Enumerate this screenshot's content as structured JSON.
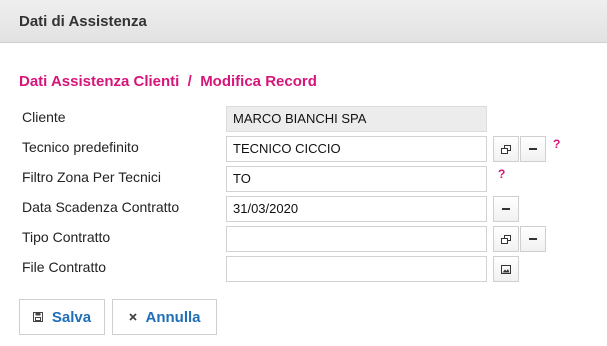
{
  "header": {
    "title": "Dati di Assistenza"
  },
  "breadcrumb": {
    "section": "Dati Assistenza Clienti",
    "separator": "/",
    "page": "Modifica Record"
  },
  "form": {
    "cliente": {
      "label": "Cliente",
      "value": "MARCO BIANCHI SPA"
    },
    "tecnico": {
      "label": "Tecnico predefinito",
      "value": "TECNICO CICCIO",
      "help": "?"
    },
    "filtro": {
      "label": "Filtro Zona Per Tecnici",
      "value": "TO",
      "help": "?"
    },
    "scadenza": {
      "label": "Data Scadenza Contratto",
      "value": "31/03/2020"
    },
    "tipo": {
      "label": "Tipo Contratto",
      "value": ""
    },
    "file": {
      "label": "File Contratto",
      "value": ""
    }
  },
  "actions": {
    "save_label": "Salva",
    "cancel_label": "Annulla"
  },
  "icons": {
    "save": "floppy-icon",
    "cancel": "close-icon",
    "lookup": "popup-window-icon",
    "clear": "minus-icon",
    "image": "image-icon"
  },
  "colors": {
    "accent": "#d6157a",
    "link": "#1f6fb8"
  }
}
